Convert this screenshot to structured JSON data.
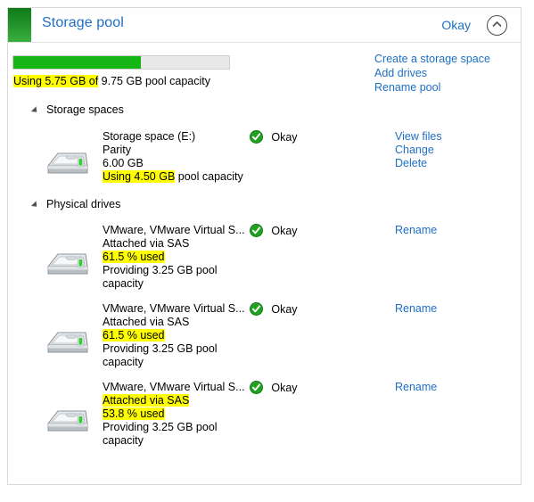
{
  "panel": {
    "title": "Storage pool",
    "status": "Okay",
    "collapse_icon": "chevron-up-icon",
    "accent_color": "#25962c"
  },
  "summary": {
    "used_gb": 5.75,
    "total_gb": 9.75,
    "fill_percent": 59,
    "caption_highlighted": "Using 5.75 GB of",
    "caption_rest": " 9.75 GB pool capacity",
    "links": [
      {
        "label": "Create a storage space",
        "name": "create-a-storage-space-link"
      },
      {
        "label": "Add drives",
        "name": "add-drives-link"
      },
      {
        "label": "Rename pool",
        "name": "rename-pool-link"
      }
    ]
  },
  "storage_spaces": {
    "group_label": "Storage spaces",
    "items": [
      {
        "name": "Storage space (E:)",
        "resiliency": "Parity",
        "size": "6.00 GB",
        "usage_highlighted": "Using 4.50 GB",
        "usage_rest": " pool capacity",
        "status": "Okay",
        "status_icon": "green-check-circle-icon",
        "actions": [
          {
            "label": "View files",
            "name": "view-files-link"
          },
          {
            "label": "Change",
            "name": "change-link"
          },
          {
            "label": "Delete",
            "name": "delete-link"
          }
        ]
      }
    ]
  },
  "physical_drives": {
    "group_label": "Physical drives",
    "items": [
      {
        "name": "VMware, VMware Virtual S...",
        "attached": "Attached via SAS",
        "attached_highlighted": false,
        "used_percent": "61.5 % used",
        "providing_line1": "Providing 3.25 GB pool",
        "providing_line2": "capacity",
        "status": "Okay",
        "status_icon": "green-check-circle-icon",
        "action_label": "Rename"
      },
      {
        "name": "VMware, VMware Virtual S...",
        "attached": "Attached via SAS",
        "attached_highlighted": false,
        "used_percent": "61.5 % used",
        "providing_line1": "Providing 3.25 GB pool",
        "providing_line2": "capacity",
        "status": "Okay",
        "status_icon": "green-check-circle-icon",
        "action_label": "Rename"
      },
      {
        "name": "VMware, VMware Virtual S...",
        "attached": "Attached via SAS",
        "attached_highlighted": true,
        "used_percent": "53.8 % used",
        "providing_line1": "Providing 3.25 GB pool",
        "providing_line2": "capacity",
        "status": "Okay",
        "status_icon": "green-check-circle-icon",
        "action_label": "Rename"
      }
    ]
  }
}
